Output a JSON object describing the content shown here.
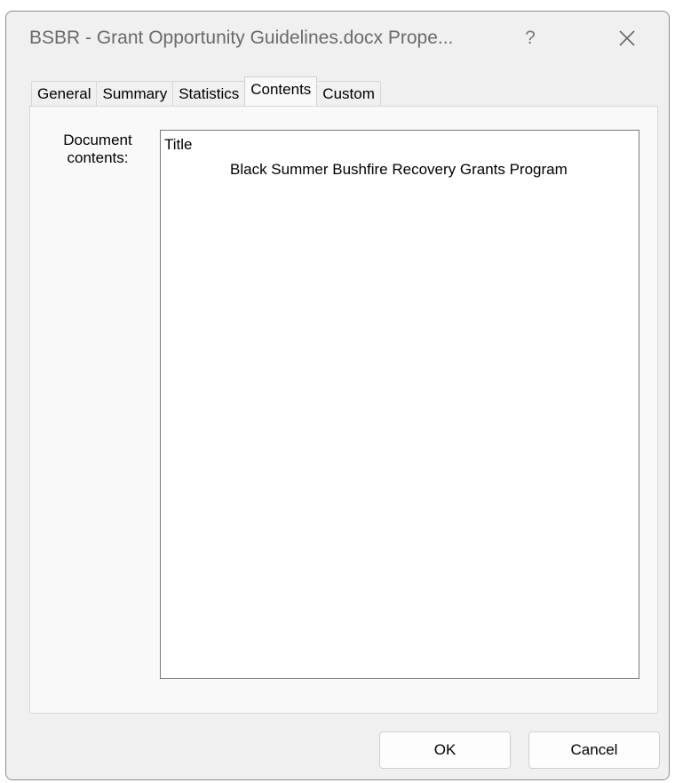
{
  "window": {
    "title": "BSBR - Grant Opportunity Guidelines.docx Prope...",
    "help_glyph": "?",
    "close_icon": "close-icon"
  },
  "tabs": [
    {
      "label": "General",
      "active": false
    },
    {
      "label": "Summary",
      "active": false
    },
    {
      "label": "Statistics",
      "active": false
    },
    {
      "label": "Contents",
      "active": true
    },
    {
      "label": "Custom",
      "active": false
    }
  ],
  "contents": {
    "label_line1": "Document",
    "label_line2": "contents:",
    "items": [
      {
        "text": "Title",
        "level": 0
      },
      {
        "text": "Black Summer Bushfire Recovery Grants Program",
        "level": 1
      }
    ]
  },
  "buttons": {
    "ok": "OK",
    "cancel": "Cancel"
  },
  "colors": {
    "dialog_bg": "#f0f0f0",
    "panel_bg": "#f9f9f9",
    "title_text": "#6a6a6a"
  }
}
